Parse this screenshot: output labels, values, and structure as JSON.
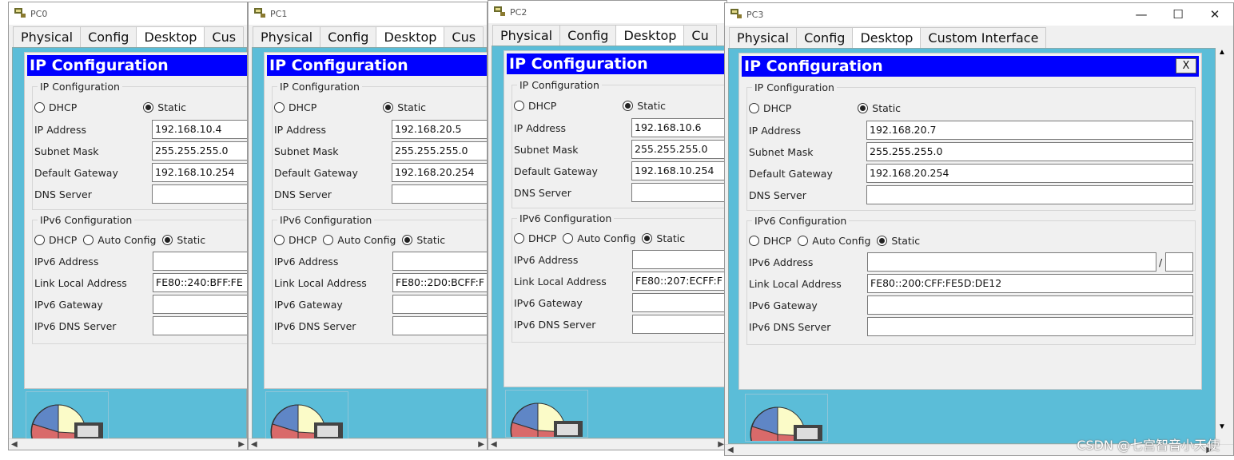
{
  "windows": [
    {
      "title": "PC0",
      "tabs": [
        "Physical",
        "Config",
        "Desktop",
        "Cus"
      ],
      "active_tab": "Desktop",
      "header": "IP Configuration",
      "ipv4_group": "IP Configuration",
      "dhcp": "DHCP",
      "static": "Static",
      "ip_label": "IP Address",
      "ip": "192.168.10.4",
      "mask_label": "Subnet Mask",
      "mask": "255.255.255.0",
      "gw_label": "Default Gateway",
      "gw": "192.168.10.254",
      "dns_label": "DNS Server",
      "dns": "",
      "ipv6_group": "IPv6 Configuration",
      "auto": "Auto Config",
      "v6addr_label": "IPv6 Address",
      "v6addr": "",
      "lla_label": "Link Local Address",
      "lla": "FE80::240:BFF:FE",
      "v6gw_label": "IPv6 Gateway",
      "v6gw": "",
      "v6dns_label": "IPv6 DNS Server",
      "v6dns": ""
    },
    {
      "title": "PC1",
      "tabs": [
        "Physical",
        "Config",
        "Desktop",
        "Cus"
      ],
      "active_tab": "Desktop",
      "header": "IP Configuration",
      "ipv4_group": "IP Configuration",
      "dhcp": "DHCP",
      "static": "Static",
      "ip_label": "IP Address",
      "ip": "192.168.20.5",
      "mask_label": "Subnet Mask",
      "mask": "255.255.255.0",
      "gw_label": "Default Gateway",
      "gw": "192.168.20.254",
      "dns_label": "DNS Server",
      "dns": "",
      "ipv6_group": "IPv6 Configuration",
      "auto": "Auto Config",
      "v6addr_label": "IPv6 Address",
      "v6addr": "",
      "lla_label": "Link Local Address",
      "lla": "FE80::2D0:BCFF:F",
      "v6gw_label": "IPv6 Gateway",
      "v6gw": "",
      "v6dns_label": "IPv6 DNS Server",
      "v6dns": ""
    },
    {
      "title": "PC2",
      "tabs": [
        "Physical",
        "Config",
        "Desktop",
        "Cu"
      ],
      "active_tab": "Desktop",
      "header": "IP Configuration",
      "ipv4_group": "IP Configuration",
      "dhcp": "DHCP",
      "static": "Static",
      "ip_label": "IP Address",
      "ip": "192.168.10.6",
      "mask_label": "Subnet Mask",
      "mask": "255.255.255.0",
      "gw_label": "Default Gateway",
      "gw": "192.168.10.254",
      "dns_label": "DNS Server",
      "dns": "",
      "ipv6_group": "IPv6 Configuration",
      "auto": "Auto Config",
      "v6addr_label": "IPv6 Address",
      "v6addr": "",
      "lla_label": "Link Local Address",
      "lla": "FE80::207:ECFF:F",
      "v6gw_label": "IPv6 Gateway",
      "v6gw": "",
      "v6dns_label": "IPv6 DNS Server",
      "v6dns": ""
    },
    {
      "title": "PC3",
      "tabs": [
        "Physical",
        "Config",
        "Desktop",
        "Custom Interface"
      ],
      "active_tab": "Desktop",
      "header": "IP Configuration",
      "close_label": "X",
      "ipv4_group": "IP Configuration",
      "dhcp": "DHCP",
      "static": "Static",
      "ip_label": "IP Address",
      "ip": "192.168.20.7",
      "mask_label": "Subnet Mask",
      "mask": "255.255.255.0",
      "gw_label": "Default Gateway",
      "gw": "192.168.20.254",
      "dns_label": "DNS Server",
      "dns": "",
      "ipv6_group": "IPv6 Configuration",
      "auto": "Auto Config",
      "v6addr_label": "IPv6 Address",
      "v6addr": "",
      "prefix_sep": "/",
      "lla_label": "Link Local Address",
      "lla": "FE80::200:CFF:FE5D:DE12",
      "v6gw_label": "IPv6 Gateway",
      "v6gw": "",
      "v6dns_label": "IPv6 DNS Server",
      "v6dns": ""
    }
  ],
  "window_controls": {
    "minimize": "—",
    "maximize": "☐",
    "close": "✕"
  },
  "watermark": "CSDN @七宫智音小天使",
  "colors": {
    "header_blue": "#0000ff",
    "desktop_teal": "#5bbdd8"
  },
  "icons": {
    "app": "packet-tracer-pc-icon",
    "pie": "pie-chart-icon"
  }
}
